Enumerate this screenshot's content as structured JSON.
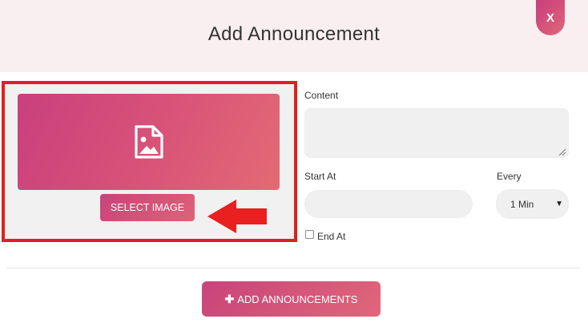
{
  "header": {
    "title": "Add Announcement",
    "close_label": "X"
  },
  "image_panel": {
    "select_label": "SELECT IMAGE",
    "placeholder_icon": "image-file-icon",
    "annotation_icon": "red-arrow-icon"
  },
  "form": {
    "content_label": "Content",
    "content_value": "",
    "start_label": "Start At",
    "start_value": "",
    "every_label": "Every",
    "every_value": "1 Min",
    "end_label": "End At",
    "end_checked": false
  },
  "footer": {
    "add_label": "ADD ANNOUNCEMENTS",
    "add_icon": "plus-icon"
  },
  "colors": {
    "accent_start": "#c83d7c",
    "accent_end": "#e0677a",
    "header_bg": "#f9eef0",
    "highlight_border": "#e0201f"
  }
}
